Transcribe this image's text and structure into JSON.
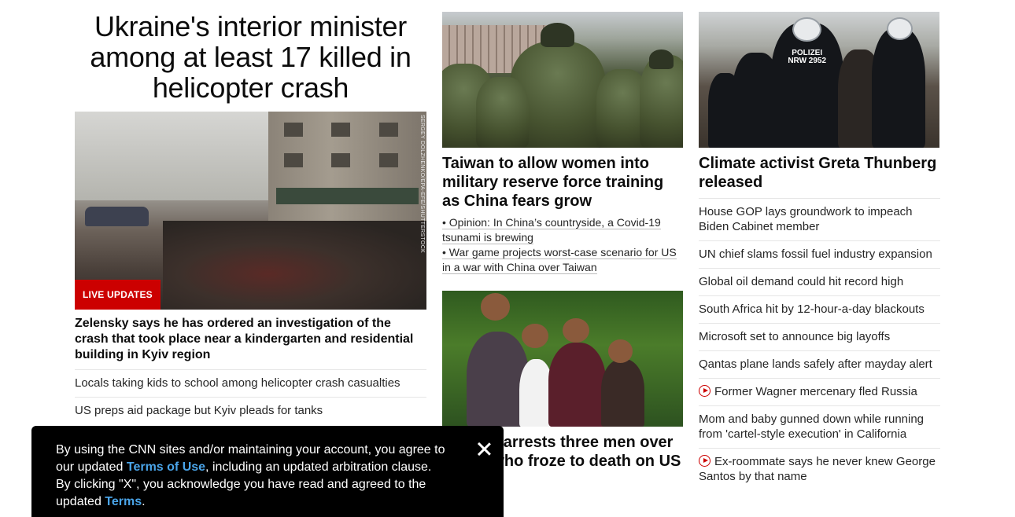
{
  "lead": {
    "headline": "Ukraine's interior minister among at least 17 killed in helicopter crash",
    "image_credit": "SERGEY DOLZHENKO/EPA-EFE/SHUTTERSTOCK",
    "badge": "LIVE UPDATES",
    "subheadline": "Zelensky says he has ordered an investigation of the crash that took place near a kindergarten and residential building in Kyiv region",
    "links": [
      "Locals taking kids to school among helicopter crash casualties",
      "US preps aid package but Kyiv pleads for tanks"
    ]
  },
  "middle": {
    "story1": {
      "headline": "Taiwan to allow women into military reserve force training as China fears grow",
      "bullets": [
        "• Opinion: In China’s countryside, a Covid-19 tsunami is brewing",
        "• War game projects worst-case scenario for US in a war with China over Taiwan"
      ]
    },
    "story2": {
      "headline": "Canada arrests three men over family who froze to death on US border"
    }
  },
  "right": {
    "headline": "Climate activist Greta Thunberg released",
    "image_text": "POLIZEI NRW 2952",
    "links": [
      {
        "text": "House GOP lays groundwork to impeach Biden Cabinet member",
        "video": false
      },
      {
        "text": "UN chief slams fossil fuel industry expansion",
        "video": false
      },
      {
        "text": "Global oil demand could hit record high",
        "video": false
      },
      {
        "text": "South Africa hit by 12-hour-a-day blackouts",
        "video": false
      },
      {
        "text": "Microsoft set to announce big layoffs",
        "video": false
      },
      {
        "text": "Qantas plane lands safely after mayday alert",
        "video": false
      },
      {
        "text": "Former Wagner mercenary fled Russia",
        "video": true
      },
      {
        "text": "Mom and baby gunned down while running from 'cartel-style execution' in California",
        "video": false
      },
      {
        "text": "Ex-roommate says he never knew George Santos by that name",
        "video": true
      }
    ]
  },
  "cookie_banner": {
    "text_1": "By using the CNN sites and/or maintaining your account, you agree to our updated ",
    "link_1": "Terms of Use",
    "text_2": ", including an updated arbitration clause. By clicking \"X\", you acknowledge you have read and agreed to the updated ",
    "link_2": "Terms",
    "text_3": "."
  },
  "colors": {
    "accent_red": "#cc0000",
    "link_blue": "#4aa4e8",
    "banner_bg": "#000000"
  },
  "icons": {
    "video": "play-circle-icon",
    "close": "close-icon"
  }
}
